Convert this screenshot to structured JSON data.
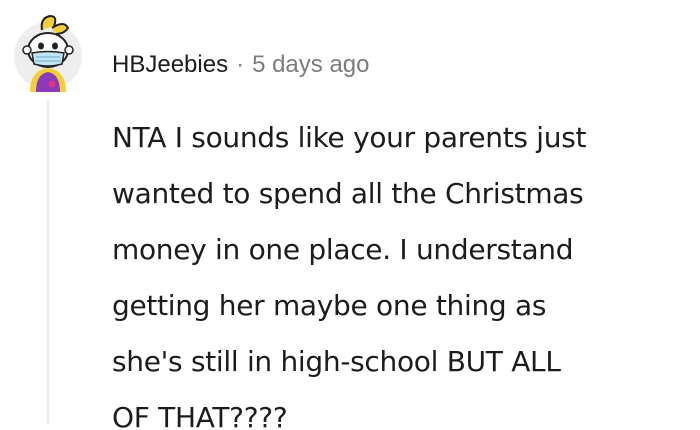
{
  "comment": {
    "username": "HBJeebies",
    "separator": "·",
    "timestamp": "5 days ago",
    "avatar_icon": "snoo-avatar-icon",
    "body_lines": [
      "NTA I sounds like your parents just",
      "wanted to spend all the Christmas",
      "money in one place. I understand",
      "getting her maybe one thing as",
      "she's still in high-school BUT ALL",
      "OF THAT????"
    ]
  },
  "colors": {
    "text": "#1c1c1c",
    "meta": "#7c7c7c",
    "thread_line": "#e9ebed",
    "avatar_bg": "#eeeeee"
  }
}
